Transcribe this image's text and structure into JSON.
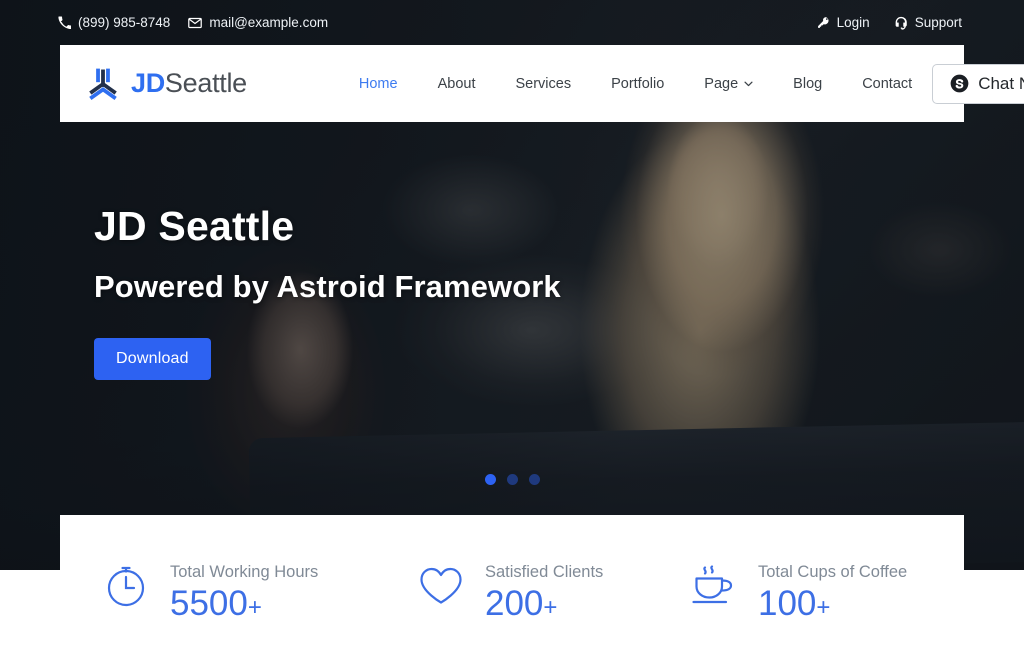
{
  "topbar": {
    "phone": "(899) 985-8748",
    "email": "mail@example.com",
    "login": "Login",
    "support": "Support",
    "icons": {
      "phone": "phone-icon",
      "email": "envelope-icon",
      "login": "key-icon",
      "support": "headset-icon"
    }
  },
  "header": {
    "logo": {
      "brand_bold": "JD",
      "brand_light": "Seattle",
      "mark": "tri-arrow-logo-icon"
    },
    "nav": [
      {
        "label": "Home",
        "active": true,
        "dropdown": false
      },
      {
        "label": "About",
        "active": false,
        "dropdown": false
      },
      {
        "label": "Services",
        "active": false,
        "dropdown": false
      },
      {
        "label": "Portfolio",
        "active": false,
        "dropdown": false
      },
      {
        "label": "Page",
        "active": false,
        "dropdown": true
      },
      {
        "label": "Blog",
        "active": false,
        "dropdown": false
      },
      {
        "label": "Contact",
        "active": false,
        "dropdown": false
      }
    ],
    "chat_button": {
      "label": "Chat Now",
      "icon": "skype-icon"
    }
  },
  "hero": {
    "title": "JD Seattle",
    "subtitle": "Powered by Astroid Framework",
    "cta_label": "Download",
    "slider_dots": 3,
    "active_dot": 1
  },
  "stats": [
    {
      "icon": "stopwatch-icon",
      "label": "Total Working Hours",
      "value": "5500",
      "suffix": "+"
    },
    {
      "icon": "heart-icon",
      "label": "Satisfied Clients",
      "value": "200",
      "suffix": "+"
    },
    {
      "icon": "coffee-cup-icon",
      "label": "Total Cups of Coffee",
      "value": "100",
      "suffix": "+"
    }
  ],
  "colors": {
    "accent_blue": "#2d62f2",
    "stat_blue": "#3d6fe5",
    "nav_active": "#3d7bf0",
    "dark_bg": "#141a20",
    "label_gray": "#808a96"
  }
}
